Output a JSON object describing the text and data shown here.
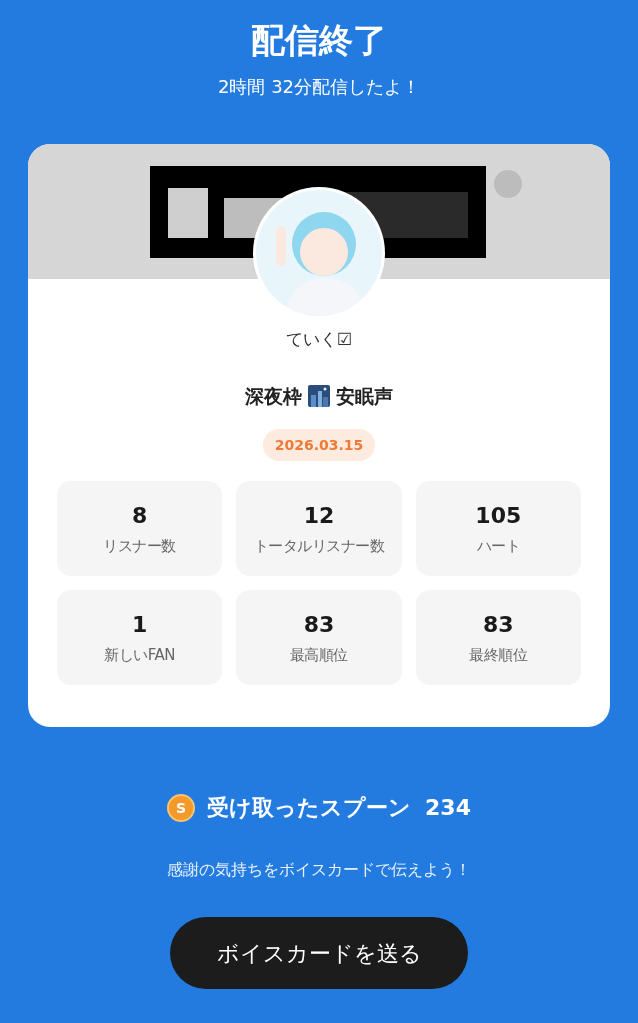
{
  "header": {
    "title": "配信終了",
    "subtitle": "2時間 32分配信したよ！"
  },
  "card": {
    "user_name": "ていく☑",
    "title_parts": [
      "深夜枠",
      "安眠声"
    ],
    "date": "2026.03.15",
    "stats": [
      {
        "value": "8",
        "label": "リスナー数"
      },
      {
        "value": "12",
        "label": "トータルリスナー数"
      },
      {
        "value": "105",
        "label": "ハート"
      },
      {
        "value": "1",
        "label": "新しいFAN"
      },
      {
        "value": "83",
        "label": "最高順位"
      },
      {
        "value": "83",
        "label": "最終順位"
      }
    ]
  },
  "spoons": {
    "coin_letter": "S",
    "label": "受け取ったスプーン",
    "count": "234"
  },
  "message": "感謝の気持ちをボイスカードで伝えよう！",
  "button": "ボイスカードを送る"
}
